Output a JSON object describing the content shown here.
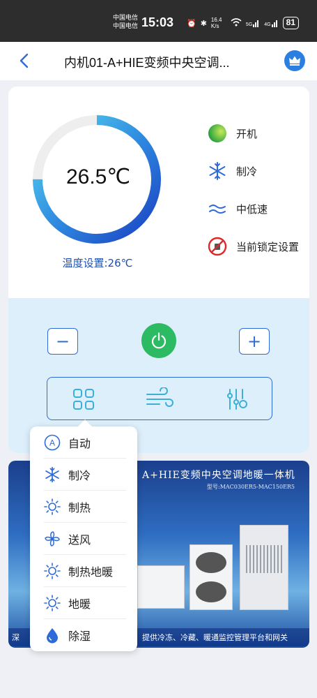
{
  "status_bar": {
    "carrier_1": "中国电信",
    "carrier_2": "中国电信",
    "time": "15:03",
    "net_speed": "16.4 K/s",
    "sig_5g": "5G",
    "sig_4g": "4G",
    "battery": "81"
  },
  "header": {
    "title": "内机01-A+HIE变频中央空调..."
  },
  "thermostat": {
    "current_temp": "26.5℃",
    "set_temp_label": "温度设置:26℃",
    "gauge_fraction": 0.75
  },
  "status": [
    {
      "label": "开机",
      "icon": "power-status-icon"
    },
    {
      "label": "制冷",
      "icon": "snowflake-icon"
    },
    {
      "label": "中低速",
      "icon": "fan-speed-icon"
    },
    {
      "label": "当前锁定设置",
      "icon": "lock-disabled-icon"
    }
  ],
  "controls": {
    "minus": "−",
    "plus": "+"
  },
  "banner": {
    "title": "A+HIE变频中央空调地暖一体机",
    "model": "型号:MAC030ER5-MAC150ER5",
    "slogan": "提供冷冻、冷藏、暖通监控管理平台和网关",
    "left_text": "深"
  },
  "mode_menu": {
    "items": [
      {
        "label": "自动",
        "icon": "auto-icon"
      },
      {
        "label": "制冷",
        "icon": "snowflake-icon"
      },
      {
        "label": "制热",
        "icon": "sun-icon"
      },
      {
        "label": "送风",
        "icon": "fan-icon"
      },
      {
        "label": "制热地暖",
        "icon": "sun-icon"
      },
      {
        "label": "地暖",
        "icon": "sun-icon"
      },
      {
        "label": "除湿",
        "icon": "droplet-icon"
      }
    ]
  },
  "colors": {
    "accent_blue": "#2f6bd8",
    "power_green": "#2cba62",
    "control_bg": "#ddeffb",
    "status_bar_bg": "#2d2d2d"
  }
}
